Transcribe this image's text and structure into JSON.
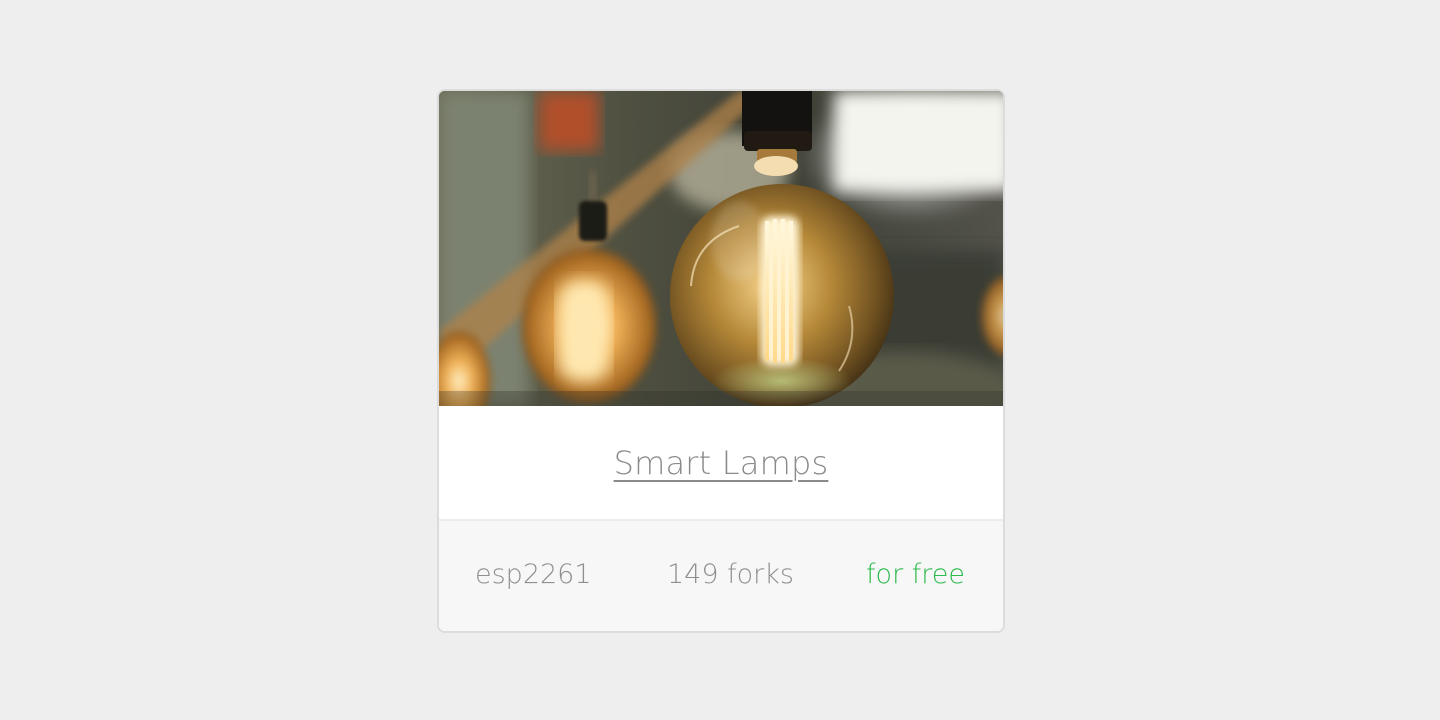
{
  "card": {
    "image": {
      "subject": "hanging-edison-light-bulbs"
    },
    "title": "Smart Lamps",
    "author": "esp2261",
    "forks": "149 forks",
    "price": "for free"
  },
  "colors": {
    "background": "#eeeeee",
    "card_border": "#dcdcdc",
    "footer_bg": "#f7f7f7",
    "title_text": "#8a8a8a",
    "meta_text": "#8f8f8f",
    "price_text": "#2dba4e"
  }
}
